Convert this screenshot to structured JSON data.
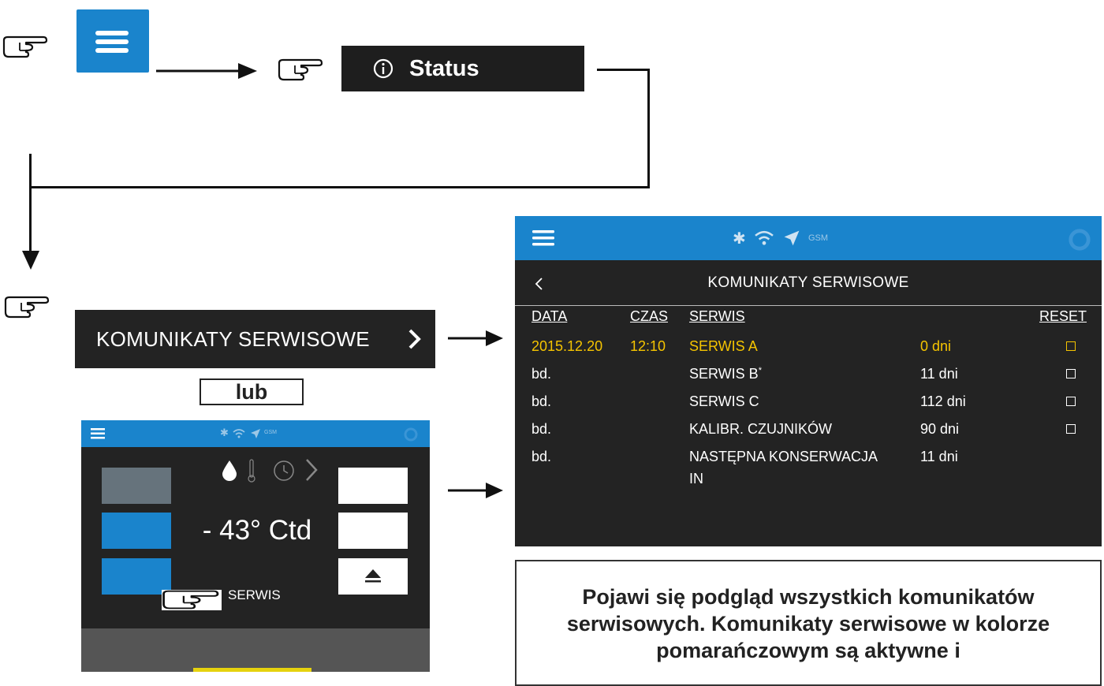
{
  "menu_button": {
    "icon": "hamburger-icon"
  },
  "status_button": {
    "icon": "info-icon",
    "label": "Status"
  },
  "service_nav_button": {
    "label": "KOMUNIKATY SERWISOWE",
    "icon": "chevron-right-icon"
  },
  "alternative_label": "lub",
  "small_screen": {
    "temperature": "- 43° Ctd",
    "service_label": "SERWIS",
    "icons": [
      "hamburger-icon",
      "bluetooth-icon",
      "wifi-icon",
      "location-icon",
      "gsm-icon",
      "drop-icon",
      "thermometer-icon",
      "clock-icon",
      "chevron-right-icon",
      "eject-icon"
    ],
    "gsm_label": "GSM"
  },
  "service_screen": {
    "status_bar": {
      "gsm_label": "GSM",
      "icons": [
        "hamburger-icon",
        "bluetooth-icon",
        "wifi-icon",
        "location-icon",
        "settings-icon"
      ]
    },
    "title": "KOMUNIKATY SERWISOWE",
    "columns": {
      "data": "DATA",
      "czas": "CZAS",
      "serwis": "SERWIS",
      "reset": "RESET"
    },
    "rows": [
      {
        "data": "2015.12.20",
        "czas": "12:10",
        "serwis": "SERWIS A",
        "sup": "",
        "dni": "0 dni",
        "active": true,
        "checkbox": true
      },
      {
        "data": "bd.",
        "czas": "",
        "serwis": "SERWIS B",
        "sup": "*",
        "dni": "11 dni",
        "active": false,
        "checkbox": true
      },
      {
        "data": "bd.",
        "czas": "",
        "serwis": "SERWIS C",
        "sup": "",
        "dni": "112 dni",
        "active": false,
        "checkbox": true
      },
      {
        "data": "bd.",
        "czas": "",
        "serwis": "KALIBR. CZUJNIKÓW",
        "sup": "",
        "dni": "90 dni",
        "active": false,
        "checkbox": true
      },
      {
        "data": "bd.",
        "czas": "",
        "serwis": "NASTĘPNA KONSERWACJA",
        "serwis_line2": "IN",
        "sup": "",
        "dni": "11 dni",
        "active": false,
        "checkbox": false
      }
    ],
    "colors": {
      "active": "#f5c400",
      "header": "#1a84cc",
      "background": "#232323"
    }
  },
  "note": "Pojawi się podgląd wszystkich komunikatów serwisowych. Komunikaty serwisowe w kolorze pomarańczowym są aktywne i"
}
